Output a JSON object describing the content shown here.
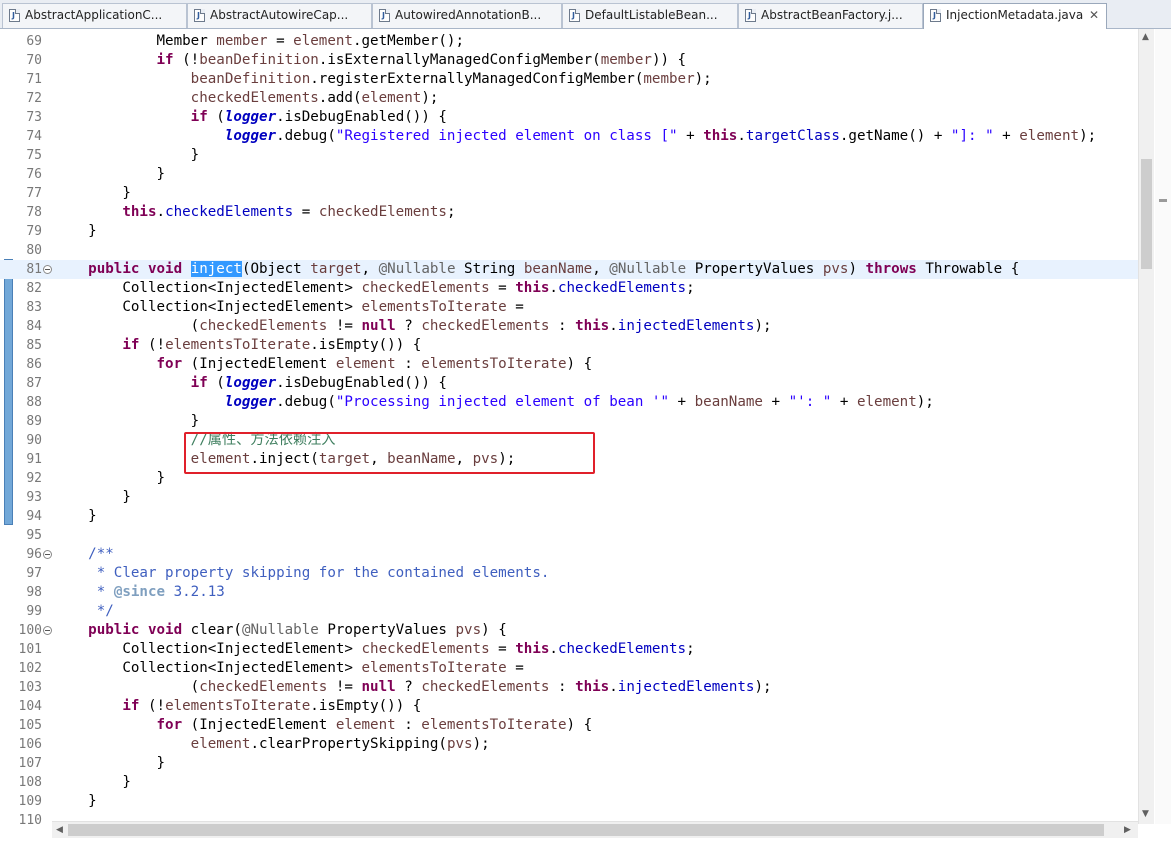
{
  "tabs": [
    {
      "label": "AbstractApplicationC...",
      "active": false
    },
    {
      "label": "AbstractAutowireCap...",
      "active": false
    },
    {
      "label": "AutowiredAnnotationB...",
      "active": false
    },
    {
      "label": "DefaultListableBean...",
      "active": false
    },
    {
      "label": "AbstractBeanFactory.j...",
      "active": false
    },
    {
      "label": "InjectionMetadata.java",
      "active": true
    }
  ],
  "tab_icon_letter": "J",
  "close_glyph": "✕",
  "lines": [
    {
      "n": "69",
      "code": "            Member member = element.getMember();"
    },
    {
      "n": "70",
      "code": "            if (!beanDefinition.isExternallyManagedConfigMember(member)) {"
    },
    {
      "n": "71",
      "code": "                beanDefinition.registerExternallyManagedConfigMember(member);"
    },
    {
      "n": "72",
      "code": "                checkedElements.add(element);"
    },
    {
      "n": "73",
      "code": "                if (logger.isDebugEnabled()) {"
    },
    {
      "n": "74",
      "code": "                    logger.debug(\"Registered injected element on class [\" + this.targetClass.getName() + \"]: \" + element);"
    },
    {
      "n": "75",
      "code": "                }"
    },
    {
      "n": "76",
      "code": "            }"
    },
    {
      "n": "77",
      "code": "        }"
    },
    {
      "n": "78",
      "code": "        this.checkedElements = checkedElements;"
    },
    {
      "n": "79",
      "code": "    }"
    },
    {
      "n": "80",
      "code": ""
    },
    {
      "n": "81",
      "code": "    public void inject(Object target, @Nullable String beanName, @Nullable PropertyValues pvs) throws Throwable {"
    },
    {
      "n": "82",
      "code": "        Collection<InjectedElement> checkedElements = this.checkedElements;"
    },
    {
      "n": "83",
      "code": "        Collection<InjectedElement> elementsToIterate ="
    },
    {
      "n": "84",
      "code": "                (checkedElements != null ? checkedElements : this.injectedElements);"
    },
    {
      "n": "85",
      "code": "        if (!elementsToIterate.isEmpty()) {"
    },
    {
      "n": "86",
      "code": "            for (InjectedElement element : elementsToIterate) {"
    },
    {
      "n": "87",
      "code": "                if (logger.isDebugEnabled()) {"
    },
    {
      "n": "88",
      "code": "                    logger.debug(\"Processing injected element of bean '\" + beanName + \"': \" + element);"
    },
    {
      "n": "89",
      "code": "                }"
    },
    {
      "n": "90",
      "code": "                //属性、方法依赖注入"
    },
    {
      "n": "91",
      "code": "                element.inject(target, beanName, pvs);"
    },
    {
      "n": "92",
      "code": "            }"
    },
    {
      "n": "93",
      "code": "        }"
    },
    {
      "n": "94",
      "code": "    }"
    },
    {
      "n": "95",
      "code": ""
    },
    {
      "n": "96",
      "code": "    /**"
    },
    {
      "n": "97",
      "code": "     * Clear property skipping for the contained elements."
    },
    {
      "n": "98",
      "code": "     * @since 3.2.13"
    },
    {
      "n": "99",
      "code": "     */"
    },
    {
      "n": "100",
      "code": "    public void clear(@Nullable PropertyValues pvs) {"
    },
    {
      "n": "101",
      "code": "        Collection<InjectedElement> checkedElements = this.checkedElements;"
    },
    {
      "n": "102",
      "code": "        Collection<InjectedElement> elementsToIterate ="
    },
    {
      "n": "103",
      "code": "                (checkedElements != null ? checkedElements : this.injectedElements);"
    },
    {
      "n": "104",
      "code": "        if (!elementsToIterate.isEmpty()) {"
    },
    {
      "n": "105",
      "code": "            for (InjectedElement element : elementsToIterate) {"
    },
    {
      "n": "106",
      "code": "                element.clearPropertySkipping(pvs);"
    },
    {
      "n": "107",
      "code": "            }"
    },
    {
      "n": "108",
      "code": "        }"
    },
    {
      "n": "109",
      "code": "    }"
    },
    {
      "n": "110",
      "code": ""
    }
  ],
  "current_line": "81",
  "selected_word": "inject",
  "fold_lines": [
    "81",
    "96",
    "100"
  ],
  "colors": {
    "keyword": "#7f0055",
    "string": "#2a00ff",
    "field": "#0000c0",
    "local_variable": "#6a3e3e",
    "comment": "#3f7f5f",
    "javadoc": "#3f5fbf",
    "annotation": "#646464",
    "annotation_box": "#e0202a",
    "selection": "#3399ff"
  }
}
